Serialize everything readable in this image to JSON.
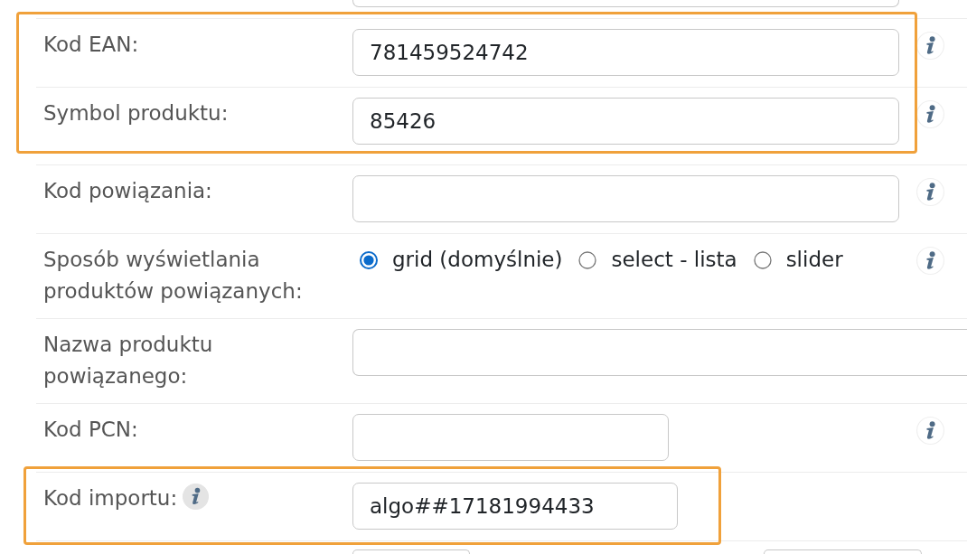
{
  "row_above": {
    "fields": [
      {
        "kind": "input"
      }
    ]
  },
  "groups": [
    {
      "highlighted": true,
      "rows": [
        {
          "label": "Kod EAN:",
          "kind": "input",
          "value": "781459524742",
          "info_icon": true,
          "label_info_icon": false
        },
        {
          "label": "Symbol produktu:",
          "kind": "input",
          "value": "85426",
          "info_icon": true,
          "label_info_icon": false
        }
      ]
    },
    {
      "highlighted": false,
      "rows": [
        {
          "label": "Kod powiązania:",
          "kind": "input",
          "info_icon": true,
          "label_info_icon": false
        },
        {
          "label": "Sposób wyświetlania produktów powiązanych:",
          "kind": "radio",
          "info_icon": true,
          "label_info_icon": false,
          "options": [
            {
              "label": "grid (domyślnie)",
              "selected": true
            },
            {
              "label": "select - lista",
              "selected": false
            },
            {
              "label": "slider",
              "selected": false
            }
          ]
        },
        {
          "label": "Nazwa produktu powiązanego:",
          "kind": "input",
          "info_icon": false,
          "label_info_icon": false
        },
        {
          "label": "Kod PCN:",
          "kind": "input",
          "info_icon": true,
          "label_info_icon": false
        }
      ]
    },
    {
      "highlighted": true,
      "rows": [
        {
          "label": "Kod importu:",
          "kind": "input",
          "value": "algo##17181994433",
          "info_icon": false,
          "label_info_icon": true
        }
      ]
    }
  ],
  "row_below": {
    "fields": [
      {
        "kind": "input"
      },
      {
        "kind": "input"
      }
    ]
  }
}
